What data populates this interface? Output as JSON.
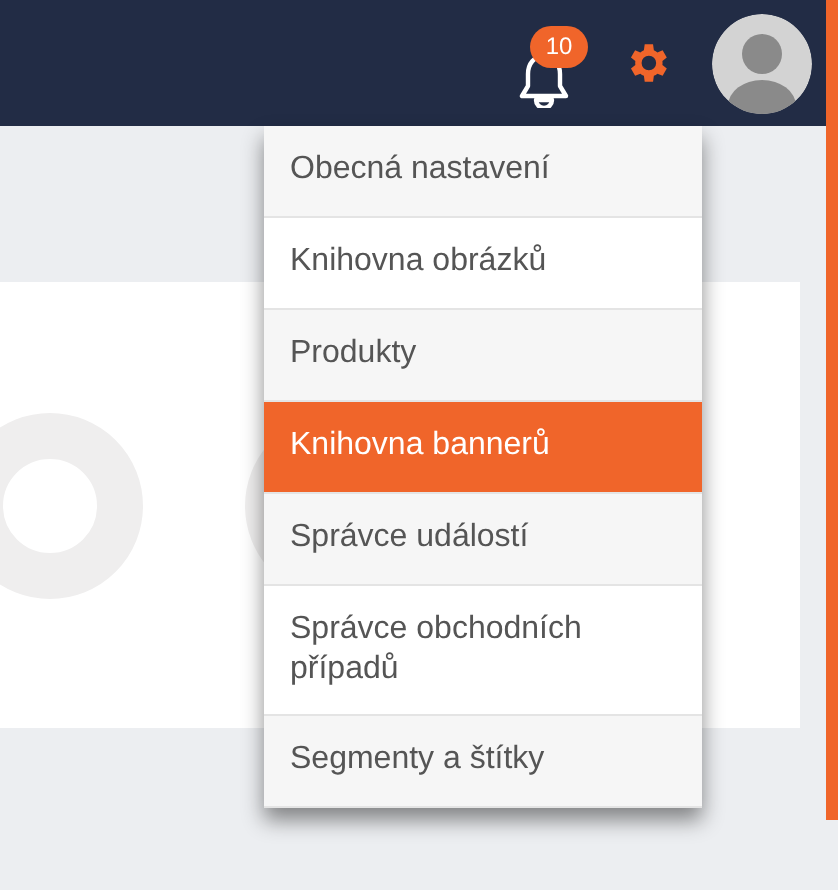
{
  "header": {
    "notifications": {
      "count": "10"
    }
  },
  "settings_menu": {
    "items": [
      {
        "label": "Obecná nastavení",
        "selected": false
      },
      {
        "label": "Knihovna obrázků",
        "selected": false
      },
      {
        "label": "Produkty",
        "selected": false
      },
      {
        "label": "Knihovna bannerů",
        "selected": true
      },
      {
        "label": "Správce událostí",
        "selected": false
      },
      {
        "label": "Správce obchodních případů",
        "selected": false
      },
      {
        "label": "Segmenty a štítky",
        "selected": false
      }
    ]
  }
}
